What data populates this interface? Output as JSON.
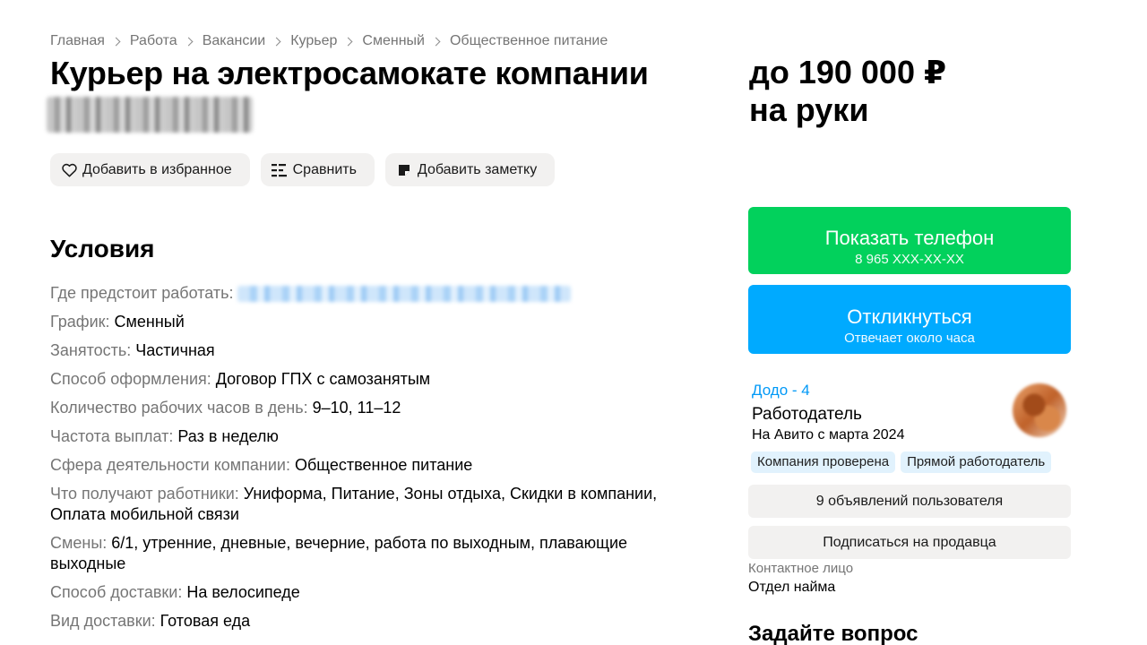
{
  "breadcrumb": [
    "Главная",
    "Работа",
    "Вакансии",
    "Курьер",
    "Сменный",
    "Общественное питание"
  ],
  "title": "Курьер на электросамокате компании",
  "actions": {
    "favorite": "Добавить в избранное",
    "compare": "Сравнить",
    "note": "Добавить заметку"
  },
  "conditions": {
    "title": "Условия",
    "items": [
      {
        "label": "Где предстоит работать:",
        "value": ""
      },
      {
        "label": "График:",
        "value": "Сменный"
      },
      {
        "label": "Занятость:",
        "value": "Частичная"
      },
      {
        "label": "Способ оформления:",
        "value": "Договор ГПХ с самозанятым"
      },
      {
        "label": "Количество рабочих часов в день:",
        "value": "9–10, 11–12"
      },
      {
        "label": "Частота выплат:",
        "value": "Раз в неделю"
      },
      {
        "label": "Сфера деятельности компании:",
        "value": "Общественное питание"
      },
      {
        "label": "Что получают работники:",
        "value": "Униформа, Питание, Зоны отдыха, Скидки в компании, Оплата мобильной связи"
      },
      {
        "label": "Смены:",
        "value": "6/1, утренние, дневные, вечерние, работа по выходным, плавающие выходные"
      },
      {
        "label": "Способ доставки:",
        "value": "На велосипеде"
      },
      {
        "label": "Вид доставки:",
        "value": "Готовая еда"
      }
    ]
  },
  "price": {
    "line1": "до 190 000 ₽",
    "line2": "на руки"
  },
  "phone_button": {
    "label": "Показать телефон",
    "number": "8 965 XXX-XX-XX"
  },
  "respond_button": {
    "label": "Откликнуться",
    "sub": "Отвечает около часа"
  },
  "seller": {
    "name": "Додо - 4",
    "role": "Работодатель",
    "since": "На Авито с марта 2024",
    "badges": [
      "Компания проверена",
      "Прямой работодатель"
    ]
  },
  "buttons": {
    "ads": "9 объявлений пользователя",
    "subscribe": "Подписаться на продавца"
  },
  "contact": {
    "label": "Контактное лицо",
    "value": "Отдел найма"
  },
  "ask": {
    "title": "Задайте вопрос"
  },
  "colors": {
    "green": "#02d15c",
    "blue": "#00aaff",
    "link": "#0099f7",
    "muted": "#757575",
    "gray_button": "#f2f1f0",
    "badge_bg": "#e1f2fd"
  },
  "icons": {
    "favorite": "heart-icon",
    "compare": "compare-list-icon",
    "note": "note-icon",
    "separator": "chevron-right-icon"
  }
}
